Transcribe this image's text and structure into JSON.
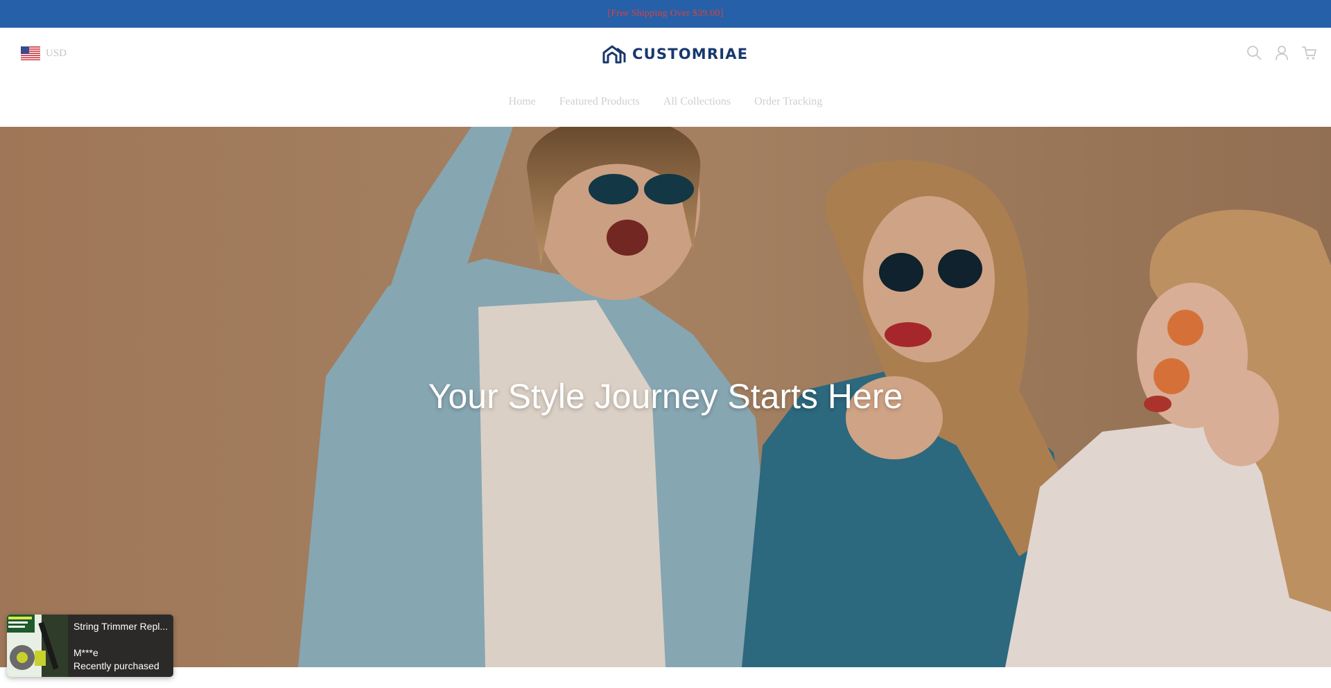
{
  "announcement": {
    "text": "[Free Shipping Over $39.00]"
  },
  "header": {
    "currency": {
      "code": "USD",
      "flag_icon": "us-flag-icon"
    },
    "logo": {
      "text": "CUSTOMRIAE",
      "icon": "house-logo-icon"
    },
    "icons": [
      "search-icon",
      "account-icon",
      "cart-icon"
    ]
  },
  "nav": {
    "items": [
      {
        "label": "Home"
      },
      {
        "label": "Featured Products"
      },
      {
        "label": "All Collections"
      },
      {
        "label": "Order Tracking"
      }
    ]
  },
  "hero": {
    "title": "Your Style Journey Starts Here"
  },
  "purchase_popup": {
    "product": "String Trimmer Repl...",
    "buyer": "M***e",
    "status": "Recently purchased"
  },
  "colors": {
    "announcement_bg": "#2560a8",
    "announcement_text": "#d9433f",
    "logo": "#17386e",
    "hero_bg": "#ab8463",
    "popup_bg": "#2b2a28"
  }
}
